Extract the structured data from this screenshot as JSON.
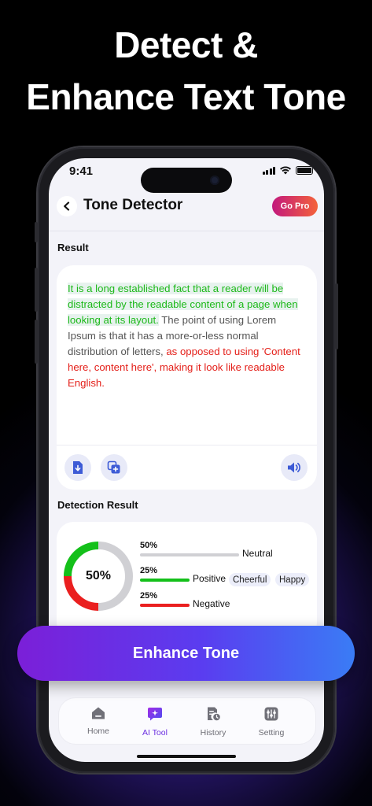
{
  "headline": {
    "line1": "Detect &",
    "line2": "Enhance Text Tone"
  },
  "status_bar": {
    "time": "9:41"
  },
  "header": {
    "title": "Tone Detector",
    "go_pro": "Go Pro"
  },
  "result": {
    "section_label": "Result",
    "text_green": "It is a long established fact that a reader will be distracted by the readable content of a page when looking at its layout.",
    "text_neutral": " The point of using Lorem Ipsum is that it has a more-or-less normal distribution of letters,",
    "text_red": " as opposed to using 'Content here, content here', making it look like readable English."
  },
  "detection": {
    "section_label": "Detection Result",
    "center_label": "50%",
    "rows": [
      {
        "percent": "50%",
        "value": 50,
        "name": "Neutral",
        "color": "#d0d0d4",
        "tags": []
      },
      {
        "percent": "25%",
        "value": 25,
        "name": "Positive",
        "color": "#14c01a",
        "tags": [
          "Cheerful",
          "Happy"
        ]
      },
      {
        "percent": "25%",
        "value": 25,
        "name": "Negative",
        "color": "#ea1f1f",
        "tags": []
      }
    ]
  },
  "enhance_button": "Enhance Tone",
  "nav": {
    "items": [
      {
        "label": "Home",
        "icon": "home-icon"
      },
      {
        "label": "AI Tool",
        "icon": "ai-tool-icon"
      },
      {
        "label": "History",
        "icon": "history-icon"
      },
      {
        "label": "Setting",
        "icon": "settings-icon"
      }
    ],
    "active": "AI Tool"
  },
  "colors": {
    "accent": "#6a2ee0",
    "positive": "#14c01a",
    "negative": "#ea1f1f",
    "neutral": "#d0d0d4"
  }
}
